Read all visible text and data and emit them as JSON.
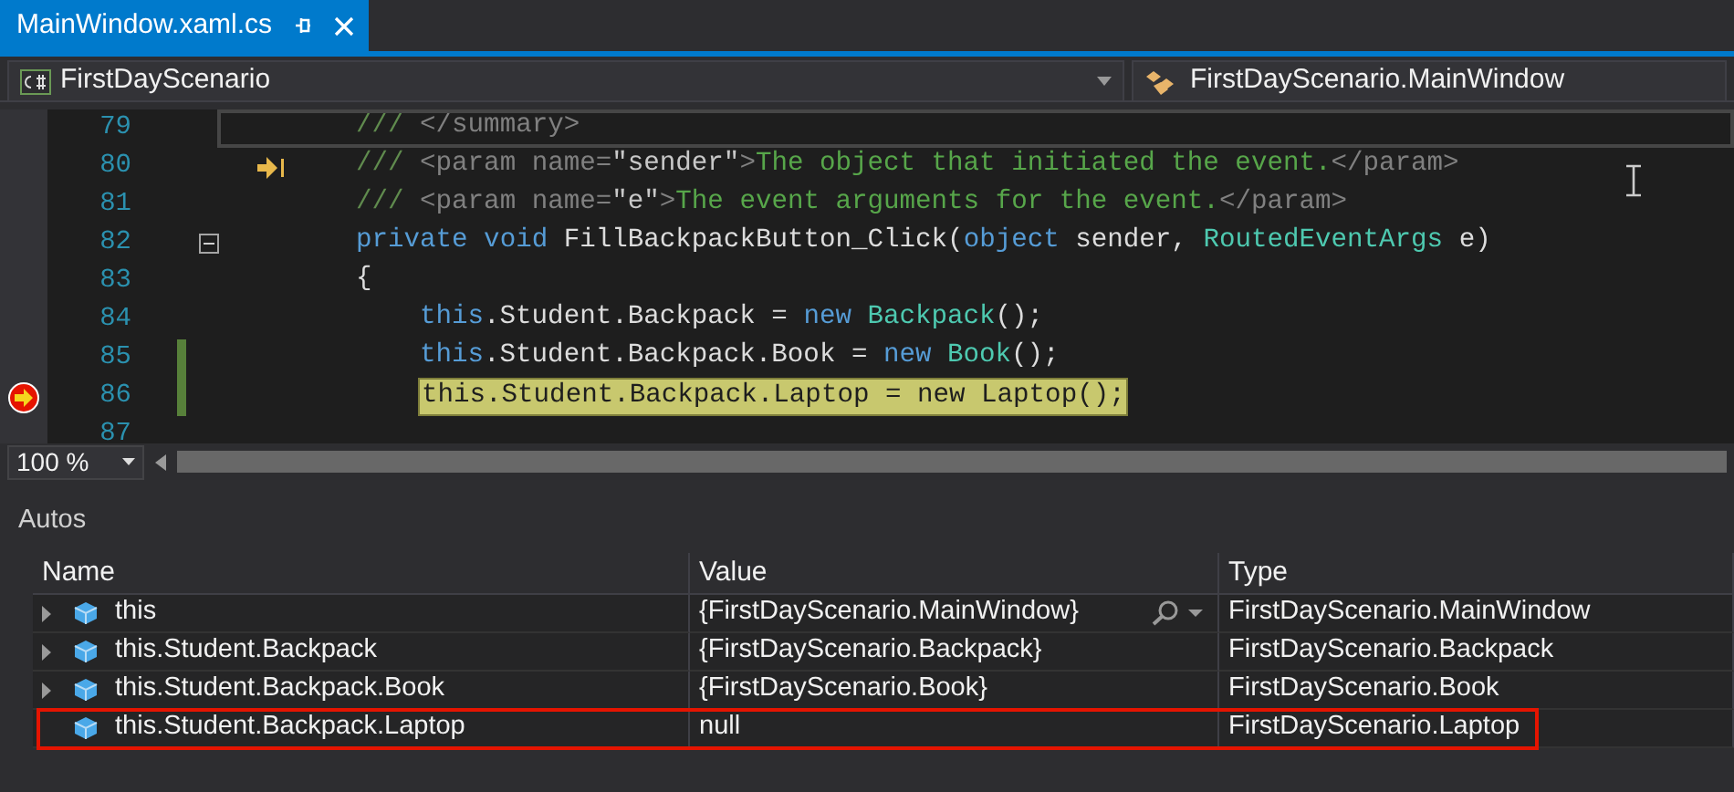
{
  "tab": {
    "title": "MainWindow.xaml.cs",
    "selected": true
  },
  "nav": {
    "project": "FirstDayScenario",
    "member": "FirstDayScenario.MainWindow"
  },
  "code_lines": [
    {
      "number": "79",
      "kind": "member",
      "caret_line": true,
      "run_to_here_arrow": false,
      "current_statement": false,
      "changed": false,
      "collapsible": false,
      "highlighted": false,
      "tokens": [
        {
          "text": "/// ",
          "kind": "doc"
        },
        {
          "text": "</summary>",
          "kind": "tag"
        }
      ]
    },
    {
      "number": "80",
      "kind": "member",
      "caret_line": false,
      "run_to_here_arrow": true,
      "current_statement": false,
      "changed": false,
      "collapsible": false,
      "highlighted": false,
      "tokens": [
        {
          "text": "/// ",
          "kind": "doc"
        },
        {
          "text": "<param name=",
          "kind": "tag"
        },
        {
          "text": "\"sender\"",
          "kind": "attr"
        },
        {
          "text": ">",
          "kind": "tag"
        },
        {
          "text": "The object that initiated the event.",
          "kind": "comment"
        },
        {
          "text": "</param>",
          "kind": "tag"
        }
      ]
    },
    {
      "number": "81",
      "kind": "member",
      "caret_line": false,
      "run_to_here_arrow": false,
      "current_statement": false,
      "changed": false,
      "collapsible": false,
      "highlighted": false,
      "tokens": [
        {
          "text": "/// ",
          "kind": "doc"
        },
        {
          "text": "<param name=",
          "kind": "tag"
        },
        {
          "text": "\"e\"",
          "kind": "attr"
        },
        {
          "text": ">",
          "kind": "tag"
        },
        {
          "text": "The event arguments for the event.",
          "kind": "comment"
        },
        {
          "text": "</param>",
          "kind": "tag"
        }
      ]
    },
    {
      "number": "82",
      "kind": "member",
      "caret_line": false,
      "run_to_here_arrow": false,
      "current_statement": false,
      "changed": false,
      "collapsible": true,
      "highlighted": false,
      "tokens": [
        {
          "text": "private void ",
          "kind": "keyword"
        },
        {
          "text": "FillBackpackButton_Click(",
          "kind": "plain"
        },
        {
          "text": "object",
          "kind": "keyword"
        },
        {
          "text": " sender, ",
          "kind": "plain"
        },
        {
          "text": "RoutedEventArgs",
          "kind": "type"
        },
        {
          "text": " e)",
          "kind": "plain"
        }
      ]
    },
    {
      "number": "83",
      "kind": "member",
      "caret_line": false,
      "run_to_here_arrow": false,
      "current_statement": false,
      "changed": false,
      "collapsible": false,
      "highlighted": false,
      "tokens": [
        {
          "text": "{",
          "kind": "plain"
        }
      ]
    },
    {
      "number": "84",
      "kind": "statement",
      "caret_line": false,
      "run_to_here_arrow": false,
      "current_statement": false,
      "changed": false,
      "collapsible": false,
      "highlighted": false,
      "tokens": [
        {
          "text": "this",
          "kind": "keyword"
        },
        {
          "text": ".Student.Backpack = ",
          "kind": "plain"
        },
        {
          "text": "new ",
          "kind": "keyword"
        },
        {
          "text": "Backpack",
          "kind": "type"
        },
        {
          "text": "();",
          "kind": "plain"
        }
      ]
    },
    {
      "number": "85",
      "kind": "statement",
      "caret_line": false,
      "run_to_here_arrow": false,
      "current_statement": false,
      "changed": true,
      "collapsible": false,
      "highlighted": false,
      "tokens": [
        {
          "text": "this",
          "kind": "keyword"
        },
        {
          "text": ".Student.Backpack.Book = ",
          "kind": "plain"
        },
        {
          "text": "new ",
          "kind": "keyword"
        },
        {
          "text": "Book",
          "kind": "type"
        },
        {
          "text": "();",
          "kind": "plain"
        }
      ]
    },
    {
      "number": "86",
      "kind": "statement",
      "caret_line": false,
      "run_to_here_arrow": false,
      "current_statement": true,
      "changed": true,
      "collapsible": false,
      "highlighted": true,
      "tokens": [
        {
          "text": "this",
          "kind": "keyword"
        },
        {
          "text": ".Student.Backpack.Laptop = ",
          "kind": "plain"
        },
        {
          "text": "new ",
          "kind": "keyword"
        },
        {
          "text": "Laptop",
          "kind": "type"
        },
        {
          "text": "();",
          "kind": "plain"
        }
      ]
    },
    {
      "number": "87",
      "kind": "empty",
      "caret_line": false,
      "run_to_here_arrow": false,
      "current_statement": false,
      "changed": false,
      "collapsible": false,
      "highlighted": false
    }
  ],
  "zoom": {
    "value": "100 %"
  },
  "autos": {
    "title": "Autos",
    "columns": [
      "Name",
      "Value",
      "Type"
    ],
    "rows": [
      {
        "name": "this",
        "value": "{FirstDayScenario.MainWindow}",
        "type": "FirstDayScenario.MainWindow",
        "expandable": true,
        "visualizer": true,
        "outlined": false
      },
      {
        "name": "this.Student.Backpack",
        "value": "{FirstDayScenario.Backpack}",
        "type": "FirstDayScenario.Backpack",
        "expandable": true,
        "visualizer": false,
        "outlined": false
      },
      {
        "name": "this.Student.Backpack.Book",
        "value": "{FirstDayScenario.Book}",
        "type": "FirstDayScenario.Book",
        "expandable": true,
        "visualizer": false,
        "outlined": false
      },
      {
        "name": "this.Student.Backpack.Laptop",
        "value": "null",
        "type": "FirstDayScenario.Laptop",
        "expandable": false,
        "visualizer": false,
        "outlined": true
      }
    ]
  }
}
